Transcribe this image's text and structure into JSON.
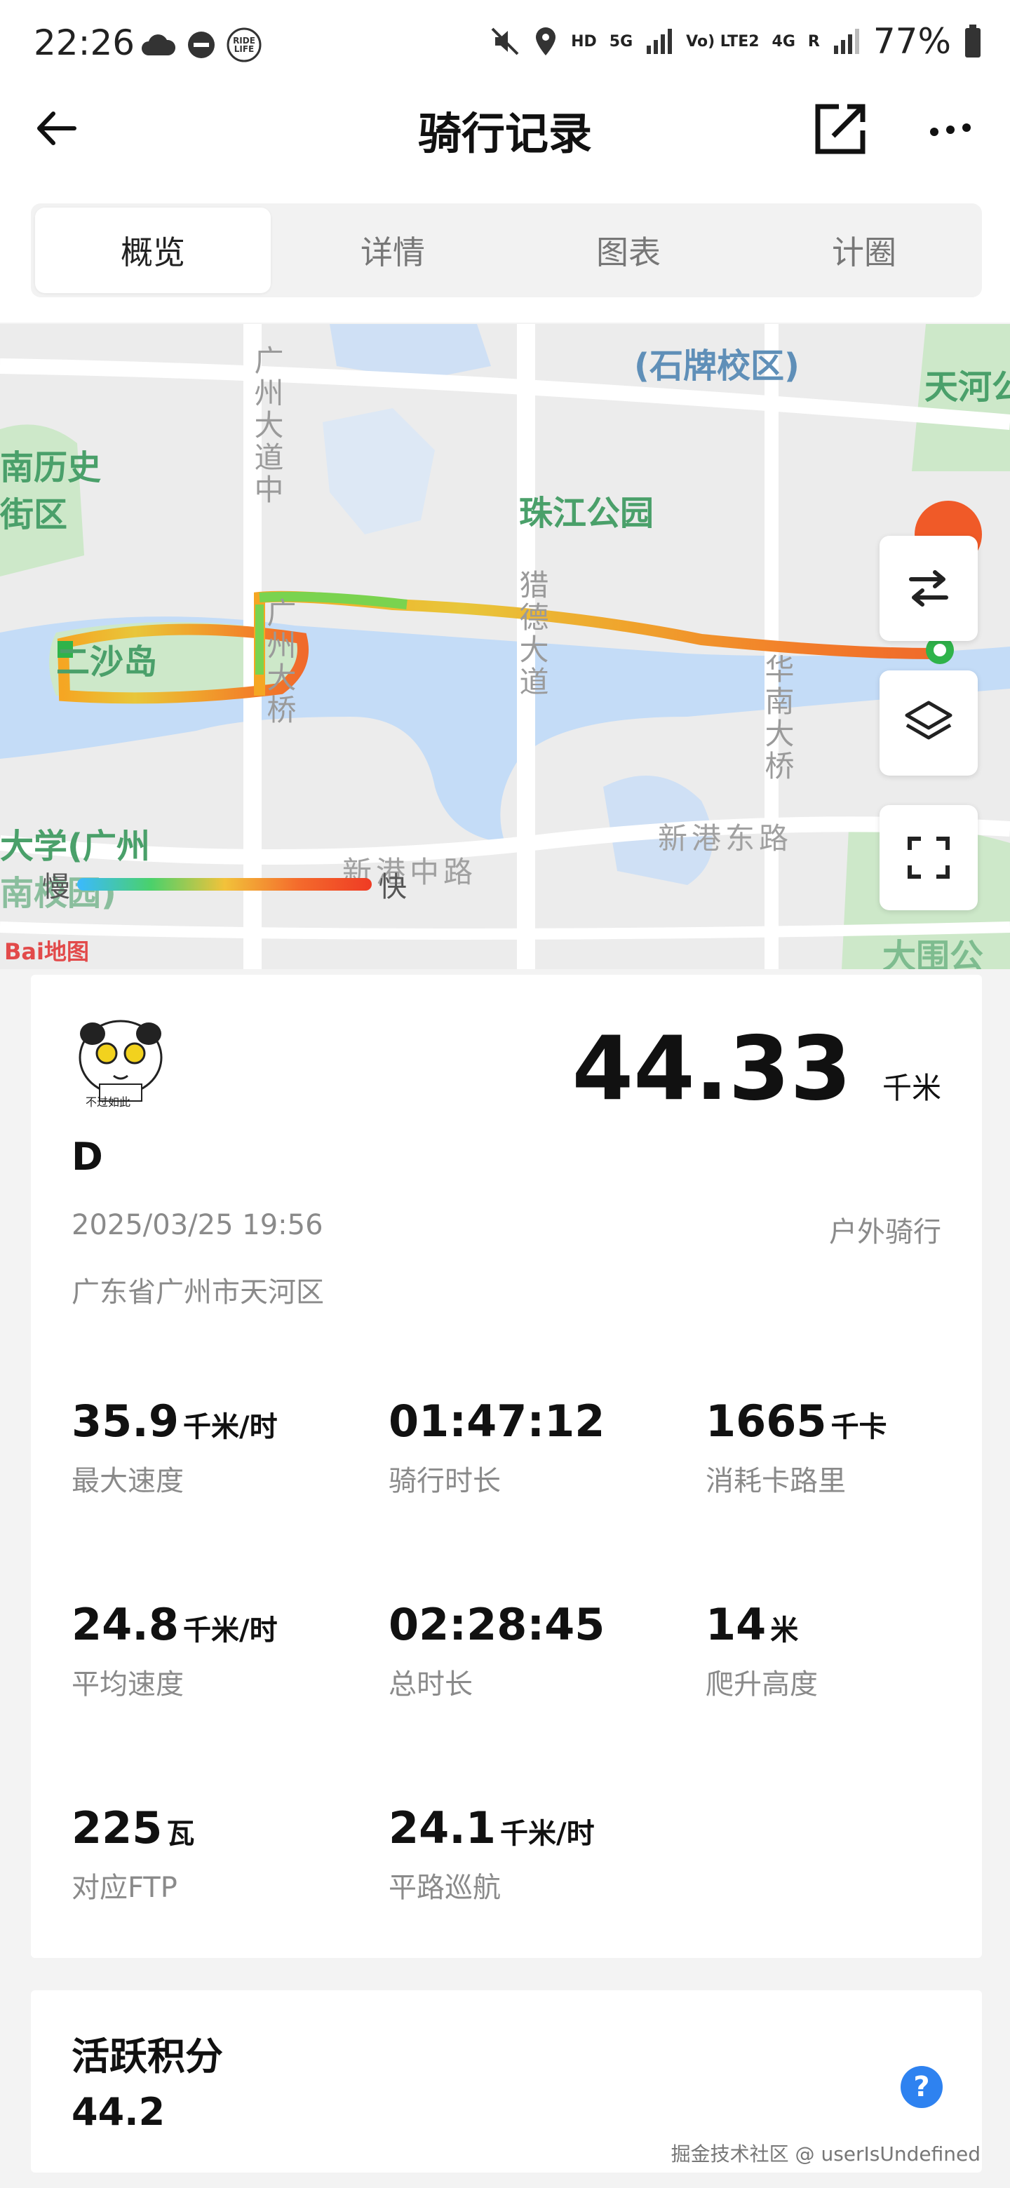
{
  "status_bar": {
    "time": "22:26",
    "net_hd": "HD",
    "net_5g": "5G",
    "volte": "Vo) LTE2",
    "net_4g": "4G",
    "roaming": "R",
    "battery": "77%"
  },
  "header": {
    "title": "骑行记录"
  },
  "tabs": [
    {
      "label": "概览",
      "active": true
    },
    {
      "label": "详情",
      "active": false
    },
    {
      "label": "图表",
      "active": false
    },
    {
      "label": "计圈",
      "active": false
    }
  ],
  "map": {
    "labels": {
      "school": "(石牌校区)",
      "tianhe": "天河公",
      "history": "南历史",
      "district": "街区",
      "guangzhou_road": "广州大道中",
      "zhujiang_park": "珠江公园",
      "ersha_island": "二沙岛",
      "bridge_left": "广州大桥",
      "liede": "猎德大道",
      "huanan": "华南大桥",
      "xingang": "新港东路",
      "xingang_mid": "新港中路",
      "univ": "大学(广州",
      "nanxiao": "南校园)",
      "datong": "大围公",
      "baidu": "Bai地图"
    },
    "legend_slow": "慢",
    "legend_fast": "快"
  },
  "ride": {
    "distance": "44.33",
    "distance_unit": "千米",
    "avatar_caption": "不过如此",
    "username": "D",
    "datetime": "2025/03/25 19:56",
    "type": "户外骑行",
    "location": "广东省广州市天河区"
  },
  "stats": [
    {
      "value": "35.9",
      "unit": "千米/时",
      "label": "最大速度"
    },
    {
      "value": "01:47:12",
      "unit": "",
      "label": "骑行时长"
    },
    {
      "value": "1665",
      "unit": "千卡",
      "label": "消耗卡路里"
    },
    {
      "value": "24.8",
      "unit": "千米/时",
      "label": "平均速度"
    },
    {
      "value": "02:28:45",
      "unit": "",
      "label": "总时长"
    },
    {
      "value": "14",
      "unit": "米",
      "label": "爬升高度"
    },
    {
      "value": "225",
      "unit": "瓦",
      "label": "对应FTP"
    },
    {
      "value": "24.1",
      "unit": "千米/时",
      "label": "平路巡航"
    }
  ],
  "score": {
    "title": "活跃积分",
    "value": "44.2",
    "help": "?"
  },
  "watermark": "掘金技术社区 @ userIsUndefined"
}
